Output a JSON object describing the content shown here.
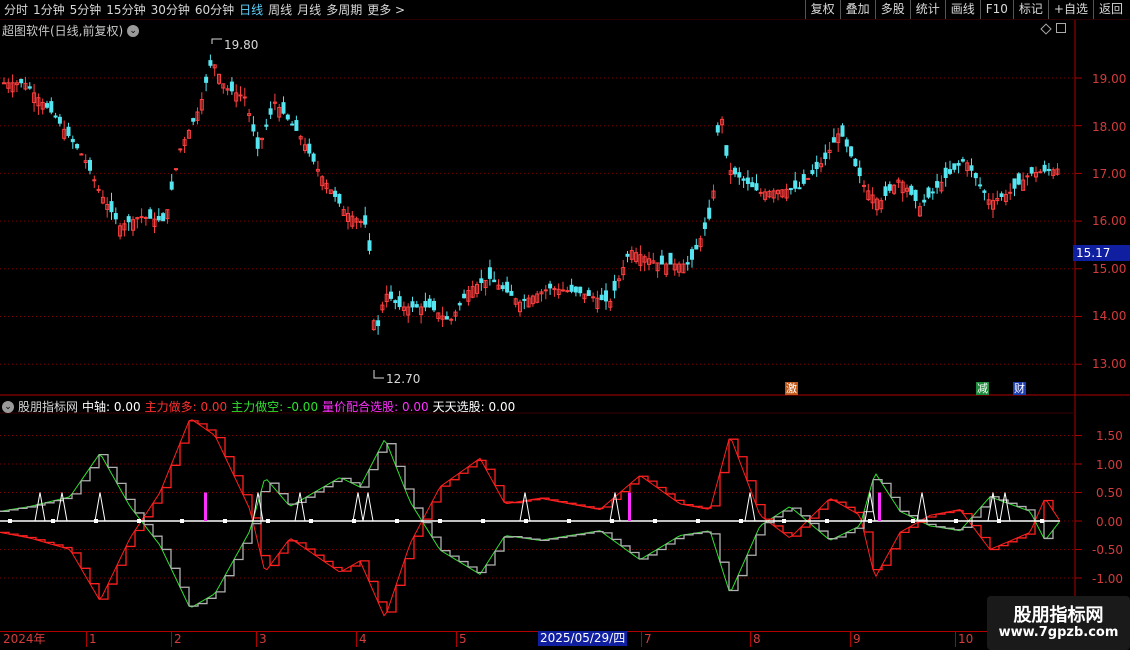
{
  "toolbar": {
    "periods": [
      "分时",
      "1分钟",
      "5分钟",
      "15分钟",
      "30分钟",
      "60分钟",
      "日线",
      "周线",
      "月线",
      "多周期",
      "更多 >"
    ],
    "active_period": "日线",
    "buttons": [
      "复权",
      "叠加",
      "多股",
      "统计",
      "画线",
      "F10",
      "标记",
      "+自选",
      "返回"
    ]
  },
  "main_chart": {
    "title": "超图软件(日线,前复权)",
    "price_axis": [
      "19.00",
      "18.00",
      "17.00",
      "16.00",
      "15.00",
      "14.00",
      "13.00"
    ],
    "high_label": "19.80",
    "low_label": "12.70",
    "last_price": "15.17",
    "badges": [
      {
        "text": "激",
        "color": "#c2591c"
      },
      {
        "text": "减",
        "color": "#1e8a3c"
      },
      {
        "text": "财",
        "color": "#1f3fb0"
      }
    ]
  },
  "indicator": {
    "name": "股朋指标网",
    "fields": [
      {
        "label": "中轴: ",
        "value": "0.00",
        "color": "#ffffff"
      },
      {
        "label": "主力做多: ",
        "value": "0.00",
        "color": "#ff3030"
      },
      {
        "label": "主力做空: ",
        "value": "-0.00",
        "color": "#30e030"
      },
      {
        "label": "量价配合选股: ",
        "value": "0.00",
        "color": "#ff30ff"
      },
      {
        "label": "天天选股: ",
        "value": "0.00",
        "color": "#ffffff"
      }
    ],
    "axis": [
      "1.50",
      "1.00",
      "0.50",
      "0.00",
      "-0.50",
      "-1.00"
    ]
  },
  "date_axis": {
    "labels": [
      "2024年",
      "1",
      "2",
      "3",
      "4",
      "5",
      "7",
      "8",
      "9",
      "10"
    ],
    "cursor_date": "2025/05/29/四"
  },
  "watermark": {
    "title": "股朋指标网",
    "url": "www.7gpzb.com"
  },
  "colors": {
    "up": "#ff4040",
    "down": "#54e5f0",
    "axis": "#b00000"
  }
}
